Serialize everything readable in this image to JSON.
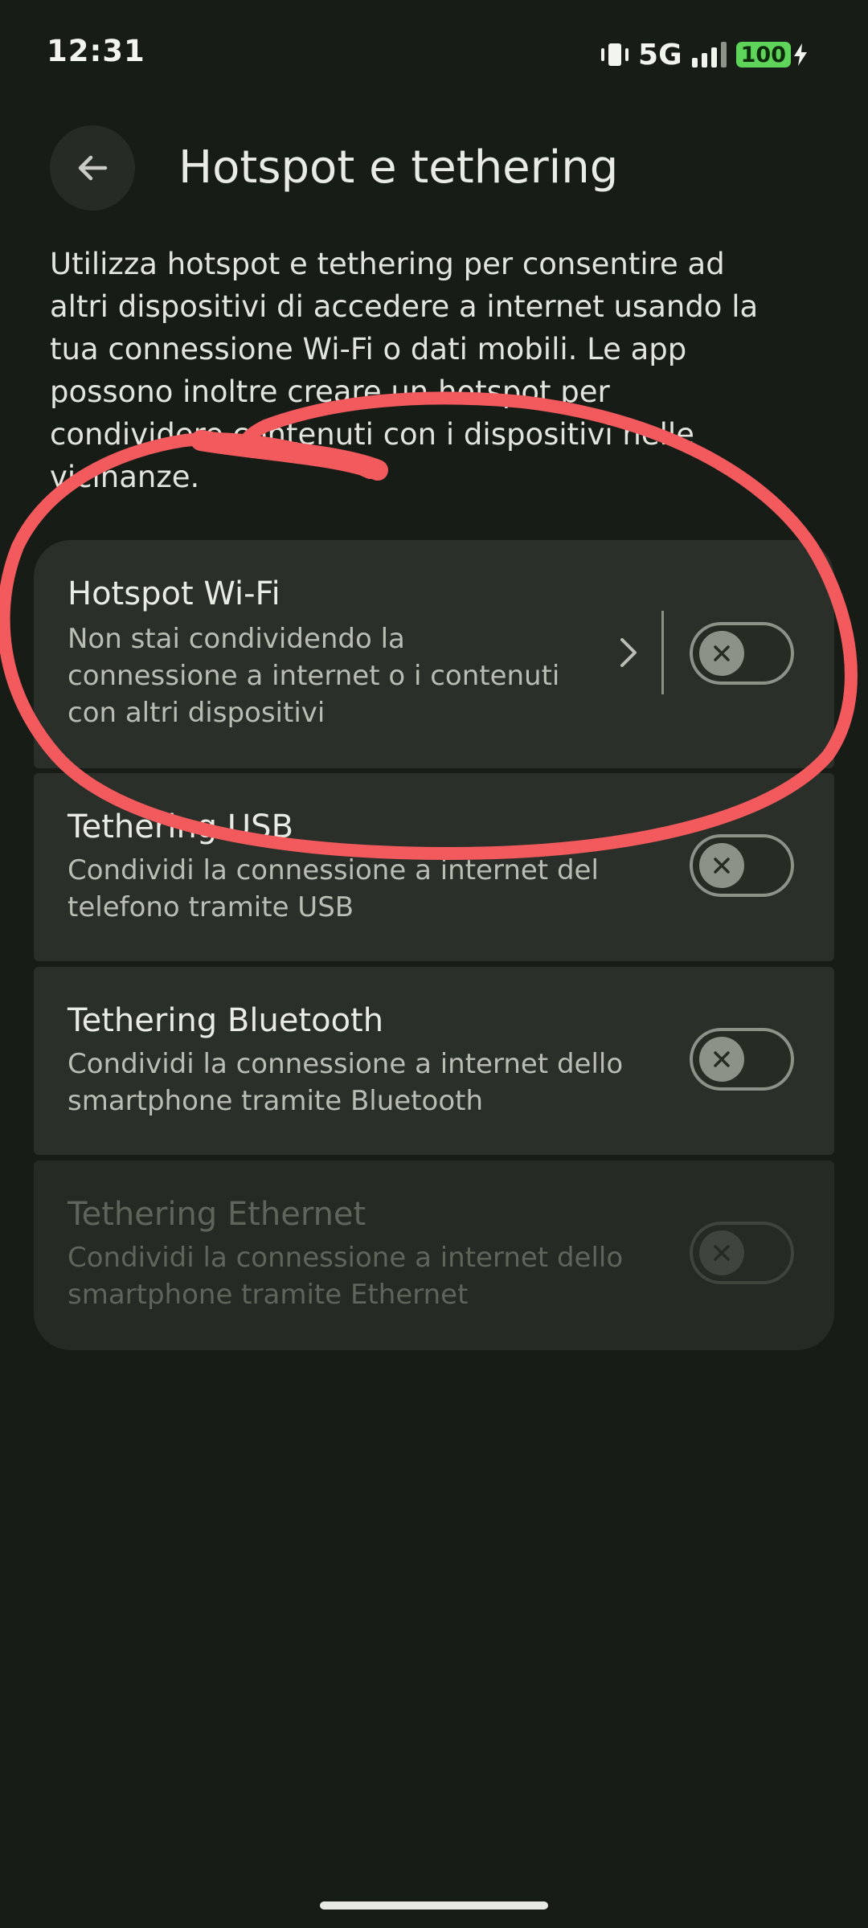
{
  "status_bar": {
    "time": "12:31",
    "network": "5G",
    "battery": "100",
    "icons": [
      "vibrate-icon",
      "signal-icon",
      "battery-icon",
      "charging-bolt-icon"
    ],
    "battery_color": "#5fd45a"
  },
  "header": {
    "back_icon": "arrow-left-icon",
    "title": "Hotspot e tethering"
  },
  "description": "Utilizza hotspot e tethering per consentire ad altri dispositivi di accedere a internet usando la tua connessione Wi-Fi o dati mobili. Le app possono inoltre creare un hotspot per condividere contenuti con i dispositivi nelle vicinanze.",
  "items": [
    {
      "title": "Hotspot Wi-Fi",
      "subtitle": "Non stai condividendo la connessione a internet o i contenuti con altri dispositivi",
      "enabled": false,
      "has_detail": true
    },
    {
      "title": "Tethering USB",
      "subtitle": "Condividi la connessione a internet del telefono tramite USB",
      "enabled": false
    },
    {
      "title": "Tethering Bluetooth",
      "subtitle": "Condividi la connessione a internet dello smartphone tramite Bluetooth",
      "enabled": false
    },
    {
      "title": "Tethering Ethernet",
      "subtitle": "Condividi la connessione a internet dello smartphone tramite Ethernet",
      "enabled": false,
      "disabled": true
    }
  ],
  "colors": {
    "background": "#181c17",
    "card": "#2a2f29",
    "annotation": "#f25a5d"
  }
}
